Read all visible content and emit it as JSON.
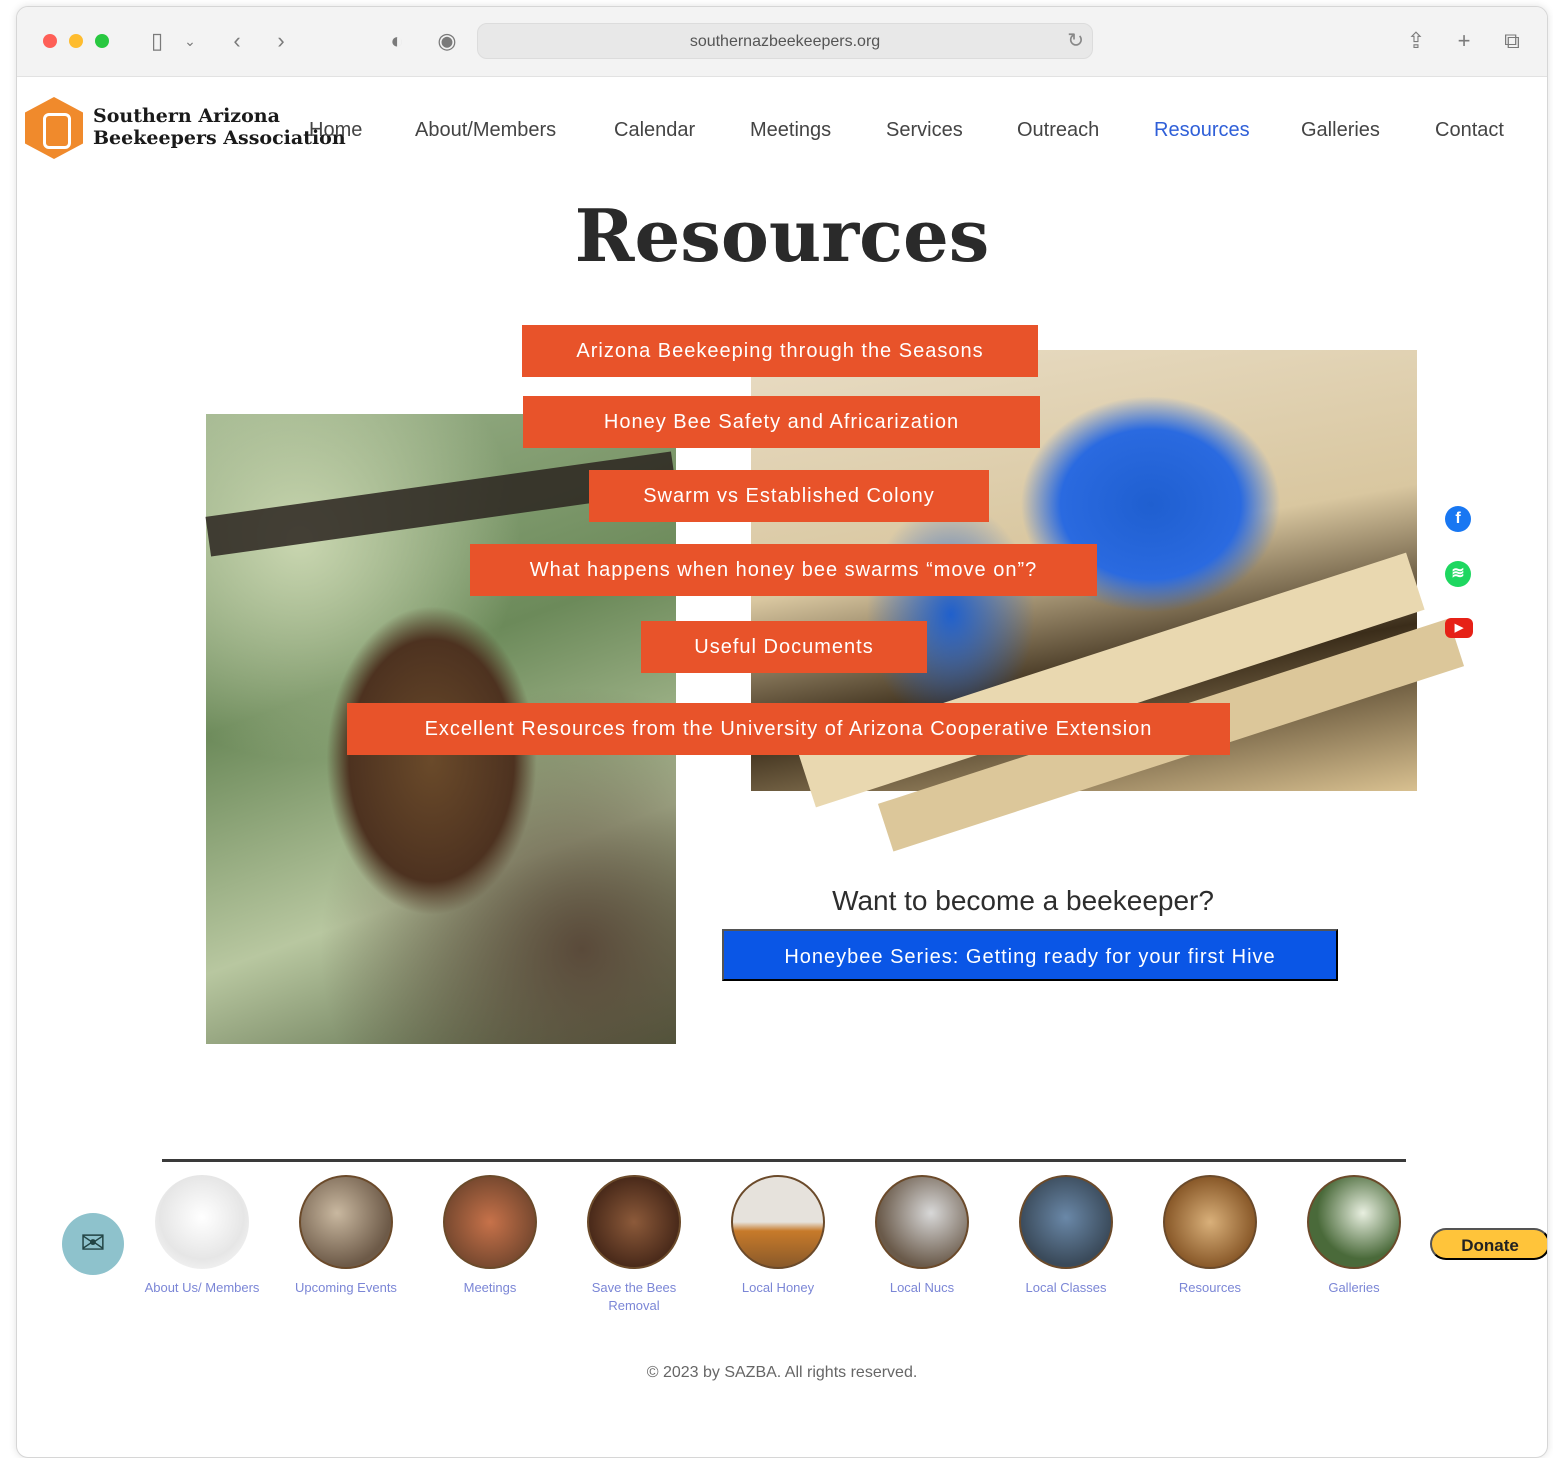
{
  "browser": {
    "url": "southernazbeekeepers.org"
  },
  "site": {
    "logo_line1": "Southern Arizona",
    "logo_line2": "Beekeepers Association"
  },
  "nav": {
    "items": [
      {
        "label": "Home"
      },
      {
        "label": "About/Members"
      },
      {
        "label": "Calendar"
      },
      {
        "label": "Meetings"
      },
      {
        "label": "Services"
      },
      {
        "label": "Outreach"
      },
      {
        "label": "Resources",
        "active": true
      },
      {
        "label": "Galleries"
      },
      {
        "label": "Contact"
      }
    ]
  },
  "page": {
    "title": "Resources"
  },
  "resources": {
    "buttons": [
      {
        "label": "Arizona Beekeeping through the Seasons"
      },
      {
        "label": "Honey Bee Safety and Africarization"
      },
      {
        "label": "Swarm vs Established Colony"
      },
      {
        "label": "What happens when honey bee swarms “move on”?"
      },
      {
        "label": "Useful Documents"
      },
      {
        "label": "Excellent Resources from the University of Arizona Cooperative Extension"
      }
    ]
  },
  "cta": {
    "heading": "Want to become a beekeeper?",
    "button": "Honeybee Series: Getting ready for your first Hive"
  },
  "social": {
    "icons": [
      "facebook-icon",
      "spotify-icon",
      "youtube-icon"
    ]
  },
  "footer": {
    "items": [
      {
        "label": "About Us/ Members"
      },
      {
        "label": "Upcoming Events"
      },
      {
        "label": "Meetings"
      },
      {
        "label": "Save the Bees Removal"
      },
      {
        "label": "Local Honey"
      },
      {
        "label": "Local Nucs"
      },
      {
        "label": "Local Classes"
      },
      {
        "label": "Resources"
      },
      {
        "label": "Galleries"
      }
    ],
    "donate": "Donate",
    "copyright": "© 2023 by SAZBA. All rights reserved."
  },
  "colors": {
    "accent_orange": "#e8532a",
    "cta_blue": "#0a56e6",
    "nav_active": "#2f5fd8",
    "footer_link": "#7b86d6"
  }
}
